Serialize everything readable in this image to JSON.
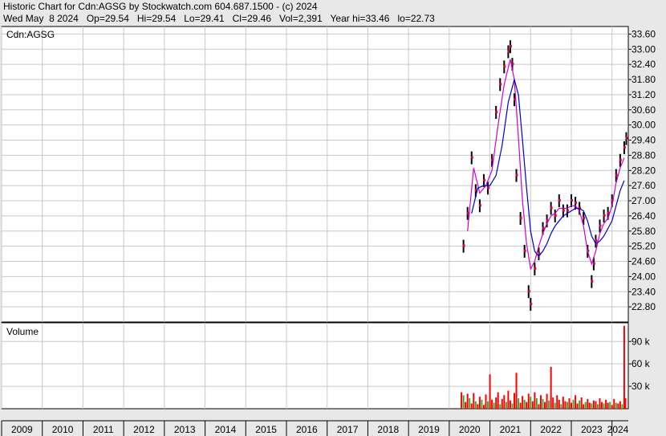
{
  "header": {
    "line1": "Historic Chart for Cdn:AGSG by Stockwatch.com 604.687.1500 - (c) 2024",
    "line2": "Wed May  8 2024   Op=29.54   Hi=29.54   Lo=29.41   Cl=29.46   Vol=2,391   Year hi=33.46   lo=22.73"
  },
  "chart_data": [
    {
      "type": "line",
      "title": "Cdn:AGSG",
      "ylabel": "",
      "ylim": [
        22.2,
        33.9
      ],
      "y_ticks": [
        "33.60",
        "33.00",
        "32.40",
        "31.80",
        "31.20",
        "30.60",
        "30.00",
        "29.40",
        "28.80",
        "28.20",
        "27.60",
        "27.00",
        "26.40",
        "25.80",
        "25.20",
        "24.60",
        "24.00",
        "23.40",
        "22.80"
      ],
      "x_ticks": [
        "2009",
        "2010",
        "2011",
        "2012",
        "2013",
        "2014",
        "2015",
        "2016",
        "2017",
        "2018",
        "2019",
        "2020",
        "2021",
        "2022",
        "2023",
        "2024"
      ],
      "xlim": [
        2009.0,
        2024.4
      ],
      "grid": true,
      "series": [
        {
          "color": "#000000",
          "x": [
            2020.35,
            2020.45,
            2020.55,
            2020.65,
            2020.75,
            2020.85,
            2020.95,
            2021.05,
            2021.15,
            2021.25,
            2021.35,
            2021.45,
            2021.5,
            2021.55,
            2021.6,
            2021.65,
            2021.75,
            2021.85,
            2021.95,
            2022.0,
            2022.1,
            2022.2,
            2022.3,
            2022.4,
            2022.5,
            2022.6,
            2022.7,
            2022.8,
            2022.9,
            2023.0,
            2023.1,
            2023.2,
            2023.3,
            2023.4,
            2023.5,
            2023.55,
            2023.6,
            2023.7,
            2023.8,
            2023.9,
            2024.0,
            2024.1,
            2024.2,
            2024.3,
            2024.35
          ],
          "values": [
            25.2,
            26.5,
            28.7,
            27.4,
            26.8,
            27.8,
            27.5,
            28.6,
            30.5,
            31.6,
            32.3,
            32.9,
            33.1,
            32.4,
            31.0,
            28.0,
            26.3,
            25.0,
            23.4,
            22.9,
            24.3,
            24.9,
            25.9,
            26.2,
            26.7,
            26.4,
            27.0,
            26.6,
            26.6,
            27.0,
            26.9,
            26.7,
            26.3,
            25.0,
            23.8,
            24.5,
            25.4,
            26.0,
            26.4,
            26.5,
            27.0,
            28.0,
            28.6,
            29.1,
            29.46
          ]
        },
        {
          "color": "#cc00cc",
          "x": [
            2020.45,
            2020.6,
            2020.75,
            2020.9,
            2021.05,
            2021.2,
            2021.35,
            2021.5,
            2021.6,
            2021.7,
            2021.8,
            2021.9,
            2022.0,
            2022.1,
            2022.2,
            2022.3,
            2022.4,
            2022.5,
            2022.6,
            2022.7,
            2022.8,
            2022.9,
            2023.0,
            2023.1,
            2023.2,
            2023.3,
            2023.4,
            2023.5,
            2023.6,
            2023.7,
            2023.8,
            2023.9,
            2024.0,
            2024.1,
            2024.2,
            2024.3
          ],
          "values": [
            25.8,
            28.3,
            27.3,
            27.6,
            28.2,
            30.0,
            31.6,
            32.6,
            31.8,
            29.5,
            27.0,
            25.3,
            24.3,
            24.6,
            25.2,
            25.7,
            26.1,
            26.4,
            26.5,
            26.7,
            26.7,
            26.7,
            26.8,
            26.8,
            26.6,
            26.0,
            25.0,
            24.5,
            25.0,
            25.7,
            26.1,
            26.3,
            26.8,
            27.7,
            28.3,
            28.7
          ]
        },
        {
          "color": "#0000cc",
          "x": [
            2020.55,
            2020.7,
            2020.85,
            2021.0,
            2021.15,
            2021.3,
            2021.45,
            2021.6,
            2021.7,
            2021.8,
            2021.9,
            2022.0,
            2022.1,
            2022.2,
            2022.3,
            2022.4,
            2022.5,
            2022.6,
            2022.7,
            2022.8,
            2022.9,
            2023.0,
            2023.1,
            2023.2,
            2023.3,
            2023.4,
            2023.5,
            2023.6,
            2023.7,
            2023.8,
            2023.9,
            2024.0,
            2024.1,
            2024.2,
            2024.3
          ],
          "values": [
            26.5,
            27.5,
            27.6,
            27.6,
            28.0,
            29.2,
            30.9,
            31.8,
            31.2,
            29.4,
            27.5,
            25.8,
            25.0,
            24.8,
            25.0,
            25.3,
            25.7,
            26.0,
            26.2,
            26.4,
            26.5,
            26.6,
            26.7,
            26.7,
            26.6,
            26.2,
            25.6,
            25.3,
            25.4,
            25.6,
            25.9,
            26.2,
            26.8,
            27.4,
            27.8
          ]
        }
      ]
    },
    {
      "type": "bar",
      "title": "Volume",
      "y_ticks": [
        "90 k",
        "60 k",
        "30 k"
      ],
      "y_tick_values": [
        90000,
        60000,
        30000
      ],
      "ylim": [
        0,
        115000
      ],
      "xlim": [
        2009.0,
        2024.4
      ],
      "grid": true,
      "series": [
        {
          "x": [
            2020.3,
            2020.35,
            2020.4,
            2020.45,
            2020.5,
            2020.55,
            2020.6,
            2020.65,
            2020.7,
            2020.75,
            2020.8,
            2020.85,
            2020.9,
            2020.95,
            2021.0,
            2021.05,
            2021.1,
            2021.15,
            2021.2,
            2021.25,
            2021.3,
            2021.35,
            2021.4,
            2021.45,
            2021.5,
            2021.55,
            2021.6,
            2021.65,
            2021.7,
            2021.75,
            2021.8,
            2021.85,
            2021.9,
            2021.95,
            2022.0,
            2022.05,
            2022.1,
            2022.15,
            2022.2,
            2022.25,
            2022.3,
            2022.35,
            2022.4,
            2022.45,
            2022.5,
            2022.55,
            2022.6,
            2022.65,
            2022.7,
            2022.75,
            2022.8,
            2022.85,
            2022.9,
            2022.95,
            2023.0,
            2023.05,
            2023.1,
            2023.15,
            2023.2,
            2023.25,
            2023.3,
            2023.35,
            2023.4,
            2023.45,
            2023.5,
            2023.55,
            2023.6,
            2023.65,
            2023.7,
            2023.75,
            2023.8,
            2023.85,
            2023.9,
            2023.95,
            2024.0,
            2024.05,
            2024.1,
            2024.15,
            2024.2,
            2024.25,
            2024.3,
            2024.33
          ],
          "values": [
            22000,
            18000,
            9000,
            20000,
            14000,
            7000,
            21000,
            10000,
            6000,
            16000,
            12000,
            5000,
            19000,
            10000,
            46000,
            12000,
            8000,
            15000,
            22000,
            6000,
            13000,
            18000,
            9000,
            24000,
            11000,
            7000,
            21000,
            48000,
            14000,
            8000,
            17000,
            12000,
            9000,
            20000,
            16000,
            10000,
            22000,
            14000,
            6000,
            18000,
            13000,
            9000,
            20000,
            11000,
            56000,
            15000,
            8000,
            18000,
            12000,
            6000,
            16000,
            10000,
            9000,
            14000,
            8000,
            12000,
            18000,
            7000,
            11000,
            15000,
            6000,
            9000,
            13000,
            8000,
            7000,
            11000,
            10000,
            6000,
            14000,
            9000,
            7000,
            12000,
            8000,
            9000,
            5000,
            13000,
            8000,
            7000,
            10000,
            6000,
            111000,
            14000
          ]
        }
      ]
    }
  ]
}
